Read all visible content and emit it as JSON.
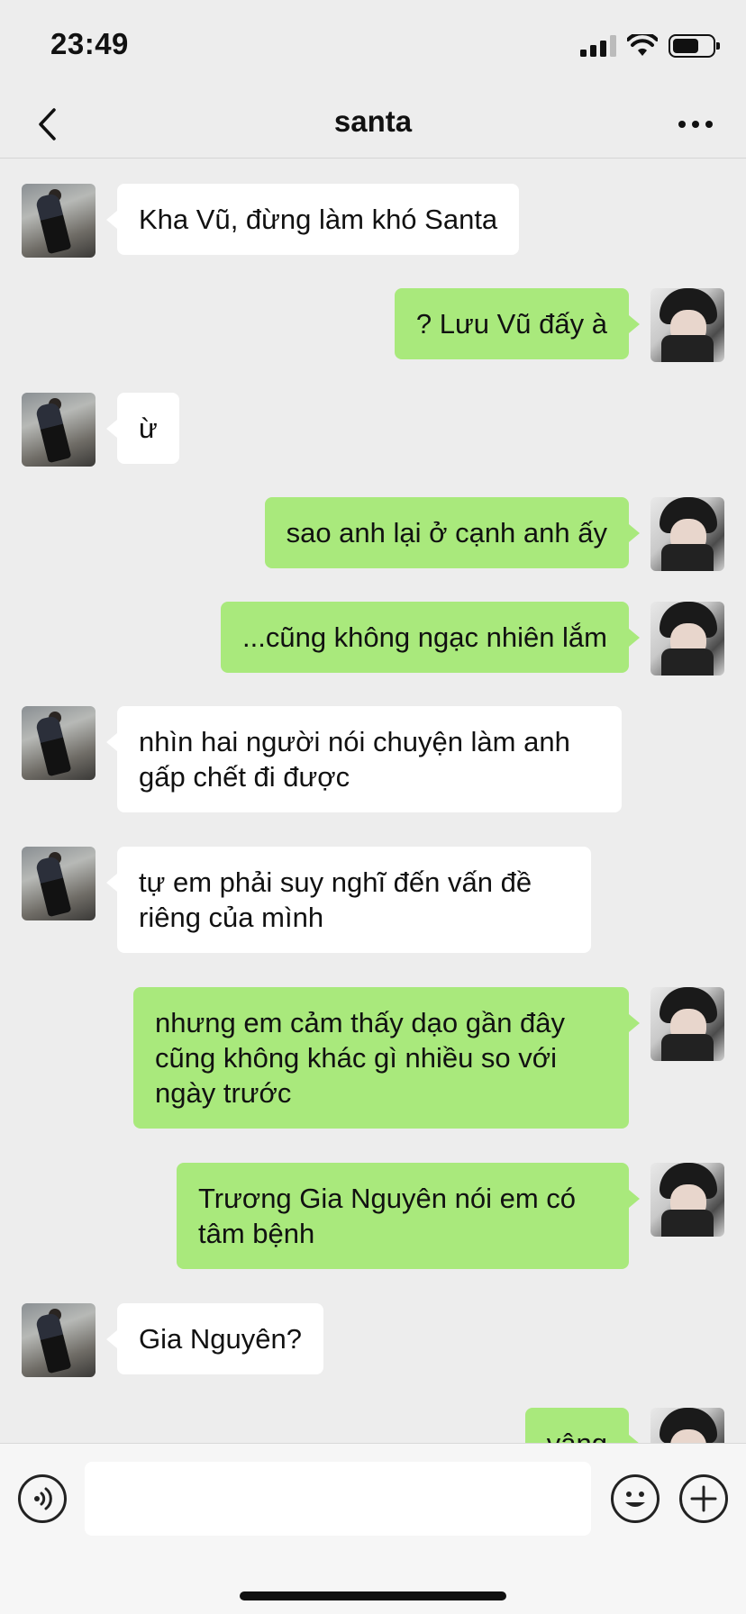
{
  "status_bar": {
    "time": "23:49"
  },
  "nav": {
    "title": "santa"
  },
  "messages": [
    {
      "side": "left",
      "text": "Kha Vũ, đừng làm khó Santa"
    },
    {
      "side": "right",
      "text": "? Lưu Vũ đấy à"
    },
    {
      "side": "left",
      "text": "ừ"
    },
    {
      "side": "right",
      "text": "sao anh lại ở cạnh anh ấy"
    },
    {
      "side": "right",
      "text": "...cũng không ngạc nhiên lắm"
    },
    {
      "side": "left",
      "text": "nhìn hai người nói chuyện làm anh gấp chết đi được"
    },
    {
      "side": "left",
      "text": "tự em phải suy nghĩ đến vấn đề riêng của mình"
    },
    {
      "side": "right",
      "text": "nhưng em cảm thấy dạo gần đây cũng không khác gì nhiều so với ngày trước"
    },
    {
      "side": "right",
      "text": "Trương Gia Nguyên nói em có tâm bệnh"
    },
    {
      "side": "left",
      "text": "Gia Nguyên?"
    },
    {
      "side": "right",
      "text": "vâng"
    }
  ],
  "input": {
    "value": ""
  },
  "colors": {
    "sent_bubble": "#a9e97c",
    "received_bubble": "#ffffff",
    "background": "#ededed"
  }
}
